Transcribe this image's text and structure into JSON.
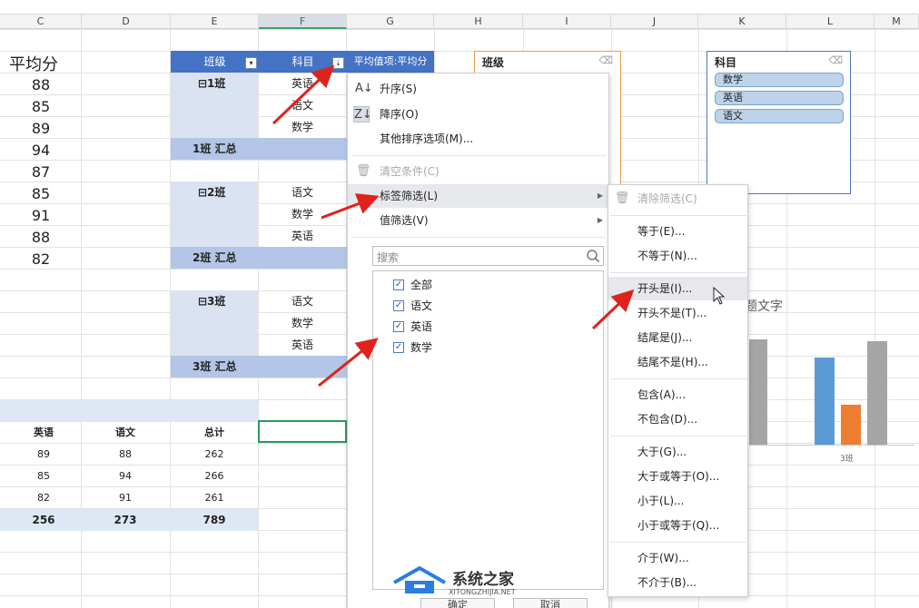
{
  "column_headers": [
    "C",
    "D",
    "E",
    "F",
    "G",
    "H",
    "I",
    "J",
    "K",
    "L",
    "M"
  ],
  "avg_table": {
    "title": "平均分",
    "values": [
      "88",
      "85",
      "89",
      "94",
      "87",
      "85",
      "91",
      "88",
      "82"
    ]
  },
  "pivot": {
    "col_class": "班级",
    "col_subject": "科目",
    "col_value": "平均值项:平均分",
    "groups": [
      {
        "label": "⊟1班",
        "subjects": [
          "英语",
          "语文",
          "数学"
        ],
        "summary": "1班 汇总"
      },
      {
        "label": "⊟2班",
        "subjects": [
          "语文",
          "数学",
          "英语"
        ],
        "summary": "2班 汇总"
      },
      {
        "label": "⊟3班",
        "subjects": [
          "语文",
          "数学",
          "英语"
        ],
        "summary": "3班 汇总"
      }
    ]
  },
  "bottom_table": {
    "headers": [
      "英语",
      "语文",
      "总计"
    ],
    "rows": [
      [
        "89",
        "88",
        "262"
      ],
      [
        "85",
        "94",
        "266"
      ],
      [
        "82",
        "91",
        "261"
      ]
    ],
    "totals": [
      "256",
      "273",
      "789"
    ]
  },
  "slicer_class": {
    "title": "班级"
  },
  "slicer_subject": {
    "title": "科目",
    "items": [
      "数学",
      "英语",
      "语文"
    ]
  },
  "chart": {
    "title_fragment": "题文字",
    "category": "3班"
  },
  "chart_data": {
    "type": "bar",
    "categories": [
      "3班"
    ],
    "series": [
      {
        "values": [
          82
        ]
      },
      {
        "values": [
          38
        ]
      },
      {
        "values": [
          98
        ]
      }
    ],
    "colors": [
      "#5b9bd5",
      "#ed7d31",
      "#a5a5a5"
    ],
    "ylim": [
      0,
      120
    ]
  },
  "filter_menu": {
    "sort_asc": "升序(S)",
    "sort_desc": "降序(O)",
    "more_sort": "其他排序选项(M)...",
    "clear": "清空条件(C)",
    "label_filter": "标签筛选(L)",
    "value_filter": "值筛选(V)",
    "search_placeholder": "搜索",
    "checklist": [
      "全部",
      "语文",
      "英语",
      "数学"
    ],
    "ok_label": "确定",
    "cancel_label": "取消"
  },
  "label_submenu": {
    "clear": "清除筛选(C)",
    "items": [
      [
        "等于(E)...",
        "不等于(N)..."
      ],
      [
        "开头是(I)...",
        "开头不是(T)...",
        "结尾是(J)...",
        "结尾不是(H)..."
      ],
      [
        "包含(A)...",
        "不包含(D)..."
      ],
      [
        "大于(G)...",
        "大于或等于(O)...",
        "小于(L)...",
        "小于或等于(Q)..."
      ],
      [
        "介于(W)...",
        "不介于(B)..."
      ]
    ]
  },
  "watermark": {
    "name": "系统之家",
    "url": "XITONGZHIJIA.NET"
  },
  "colors": {
    "pivot_header": "#4472c4",
    "pivot_band": "#dbe3f2",
    "pivot_summary": "#b4c6e7",
    "active_cell": "#2a9a5a"
  }
}
